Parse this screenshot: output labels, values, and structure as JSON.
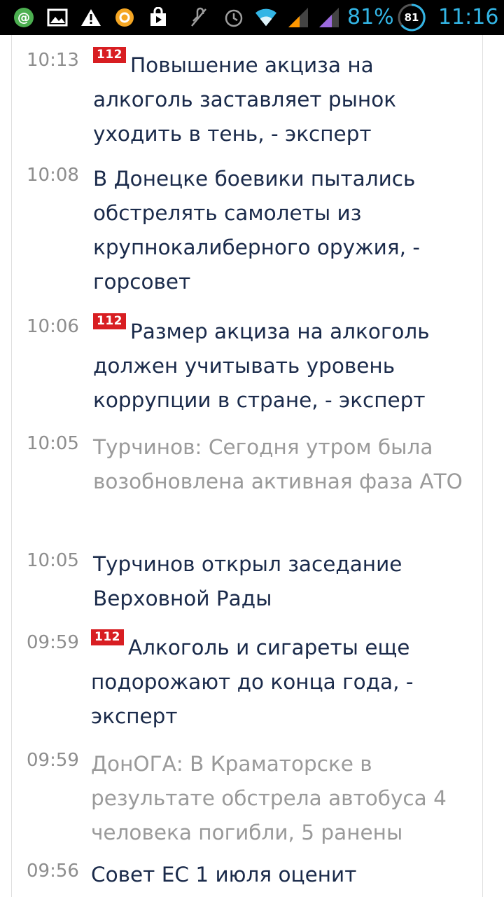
{
  "status_bar": {
    "battery_percent": "81%",
    "battery_circle": "81",
    "clock": "11:16",
    "icons": [
      "at-sign-icon",
      "gallery-icon",
      "warning-icon",
      "orange-app-icon",
      "shopping-bag-icon",
      "mute-icon",
      "alarm-icon",
      "wifi-icon",
      "signal-1-icon",
      "signal-2-icon",
      "battery-circle-icon"
    ],
    "accent_color": "#33b5e5"
  },
  "news": [
    {
      "time": "10:13",
      "badge": "112",
      "title": "Повышение акциза на алкоголь заставляет рынок уходить в тень, - эксперт",
      "read": false
    },
    {
      "time": "10:08",
      "badge": "",
      "title": "В Донецке боевики пытались обстрелять самолеты из крупнокалиберного оружия, - горсовет",
      "read": false
    },
    {
      "time": "10:06",
      "badge": "112",
      "title": "Размер акциза на алкоголь должен учитывать уровень коррупции в стране, - эксперт",
      "read": false
    },
    {
      "time": "10:05",
      "badge": "",
      "title": "Турчинов: Сегодня утром была возобновлена активная фаза АТО",
      "read": true
    },
    {
      "time": "10:05",
      "badge": "",
      "title": "Турчинов открыл заседание Верховной Рады",
      "read": false
    },
    {
      "time": "09:59",
      "badge": "112",
      "title": "Алкоголь и сигареты еще подорожают до конца года, - эксперт",
      "read": false
    },
    {
      "time": "09:59",
      "badge": "",
      "title": "ДонОГА: В Краматорске в результате обстрела автобуса 4 человека погибли, 5 ранены",
      "read": true
    },
    {
      "time": "09:56",
      "badge": "",
      "title": "Совет ЕС 1 июля оценит",
      "read": false
    }
  ],
  "colors": {
    "headline": "#1a2a4a",
    "headline_read": "#9a9a9a",
    "time": "#8d8d8d",
    "badge": "#d81e22"
  }
}
